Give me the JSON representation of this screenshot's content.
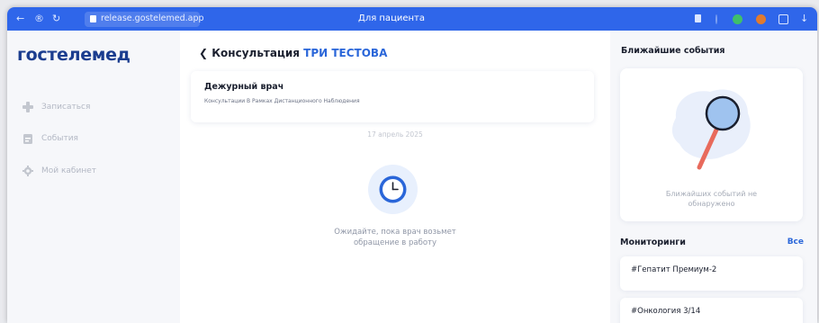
{
  "browser": {
    "url": "release.gostelemed.app",
    "tab_title": "Для пациента",
    "accent": "#2f66ea"
  },
  "sidebar": {
    "logo": "гостелемед",
    "items": [
      {
        "label": "Записаться",
        "icon": "plus-icon"
      },
      {
        "label": "События",
        "icon": "calendar-icon"
      },
      {
        "label": "Мой кабинет",
        "icon": "gear-icon"
      }
    ]
  },
  "consultation": {
    "back_label": "Консультация",
    "patient_name": "ТРИ ТЕСТОВА",
    "doctor_title": "Дежурный врач",
    "doctor_subtitle": "Консультации В Рамках Дистанционного Наблюдения",
    "date": "17 апрель 2025",
    "wait_line1": "Ожидайте, пока врач возьмет",
    "wait_line2": "обращение в работу",
    "status_icon": "clock-icon"
  },
  "events": {
    "title": "Ближайшие события",
    "empty_line1": "Ближайших событий не",
    "empty_line2": "обнаружено",
    "illustration": "magnifier-icon"
  },
  "monitorings": {
    "title": "Мониторинги",
    "all_label": "Все",
    "items": [
      "#Гепатит Премиум-2",
      "#Онкология 3/14"
    ]
  },
  "colors": {
    "brand": "#1b3d8f",
    "link": "#2a66d9",
    "muted": "#b3b8c4"
  }
}
